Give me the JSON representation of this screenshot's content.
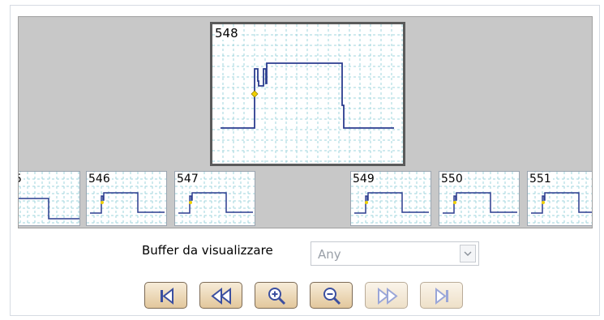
{
  "viewer": {
    "frames": [
      {
        "id": "545",
        "label": "5"
      },
      {
        "id": "546",
        "label": "546"
      },
      {
        "id": "547",
        "label": "547"
      },
      {
        "id": "548",
        "label": "548"
      },
      {
        "id": "549",
        "label": "549"
      },
      {
        "id": "550",
        "label": "550"
      },
      {
        "id": "551",
        "label": "551"
      }
    ],
    "selected_frame": "548"
  },
  "buffer": {
    "label": "Buffer da visualizzare",
    "selected": "Any"
  },
  "nav": {
    "buttons": [
      {
        "name": "first",
        "icon": "skip-first-icon",
        "enabled": true
      },
      {
        "name": "previous",
        "icon": "rewind-icon",
        "enabled": true
      },
      {
        "name": "zoom-in",
        "icon": "zoom-in-icon",
        "enabled": true
      },
      {
        "name": "zoom-out",
        "icon": "zoom-out-icon",
        "enabled": true
      },
      {
        "name": "next",
        "icon": "fast-forward-icon",
        "enabled": false
      },
      {
        "name": "last",
        "icon": "skip-last-icon",
        "enabled": false
      }
    ]
  },
  "colors": {
    "grid": "#9fd4dc",
    "trace": "#2b3d8f",
    "marker": "#f0d000",
    "button_icon": "#3b4fa0",
    "button_icon_disabled": "#9aa6d8"
  }
}
